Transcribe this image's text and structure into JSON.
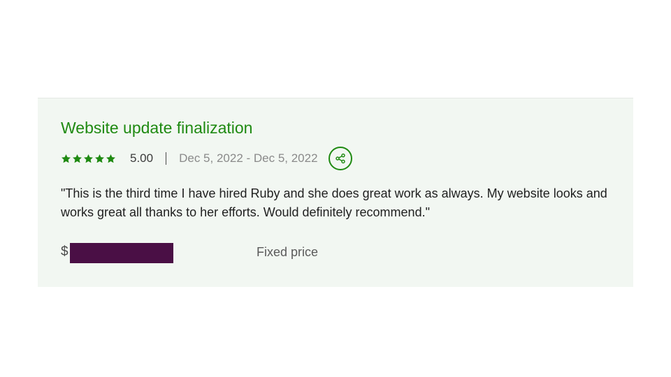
{
  "review": {
    "title": "Website update finalization",
    "rating": "5.00",
    "star_count": 5,
    "date_range": "Dec 5, 2022 - Dec 5, 2022",
    "share_icon": "share-icon",
    "quote": "\"This is the third time I have hired Ruby and she does great work as always. My website looks and works great all thanks to her efforts. Would definitely recommend.\"",
    "currency_symbol": "$",
    "price_type": "Fixed price"
  },
  "colors": {
    "accent": "#1f8a12",
    "card_background": "#f2f7f2",
    "redaction": "#4a0f45"
  }
}
